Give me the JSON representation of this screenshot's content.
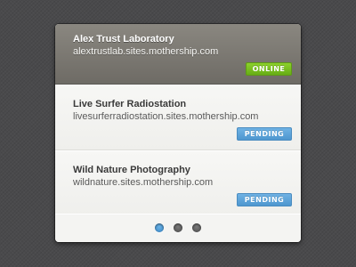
{
  "sites": [
    {
      "name": "Alex Trust Laboratory",
      "url": "alextrustlab.sites.mothership.com",
      "status": "ONLINE",
      "active": true
    },
    {
      "name": "Live Surfer Radiostation",
      "url": "livesurferradiostation.sites.mothership.com",
      "status": "PENDING",
      "active": false
    },
    {
      "name": "Wild Nature Photography",
      "url": "wildnature.sites.mothership.com",
      "status": "PENDING",
      "active": false
    }
  ],
  "pagination": {
    "pages": 3,
    "current": 1
  },
  "colors": {
    "online": "#7bc220",
    "pending": "#5fa4da",
    "active_row": "#7d7a73",
    "background": "#4a4a4c"
  }
}
